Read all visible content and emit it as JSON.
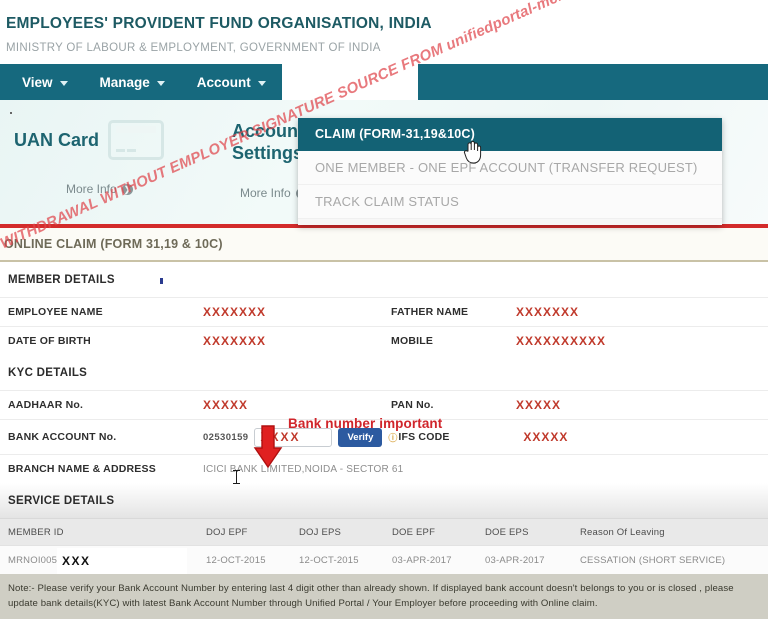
{
  "header": {
    "title": "EMPLOYEES' PROVIDENT FUND ORGANISATION, INDIA",
    "subtitle": "MINISTRY OF LABOUR & EMPLOYMENT, GOVERNMENT OF INDIA"
  },
  "nav": {
    "items": [
      {
        "label": "View",
        "has_caret": true
      },
      {
        "label": "Manage",
        "has_caret": true
      },
      {
        "label": "Account",
        "has_caret": true
      }
    ]
  },
  "dropdown": {
    "items": [
      {
        "label": "CLAIM (FORM-31,19&10C)",
        "active": true
      },
      {
        "label": "ONE MEMBER - ONE EPF ACCOUNT (TRANSFER REQUEST)",
        "active": false
      },
      {
        "label": "TRACK CLAIM STATUS",
        "active": false
      }
    ]
  },
  "hero": {
    "tiles": [
      {
        "label": "UAN Card",
        "more": "More Info"
      },
      {
        "label": "Account Settings",
        "more": "More Info"
      }
    ]
  },
  "claim_band": {
    "title": "ONLINE CLAIM (FORM 31,19 & 10C)"
  },
  "member_details": {
    "heading": "MEMBER DETAILS",
    "rows": [
      {
        "label": "EMPLOYEE NAME",
        "value": "XXXXXXX",
        "label2": "FATHER NAME",
        "value2": "XXXXXXX"
      },
      {
        "label": "DATE OF BIRTH",
        "value": "XXXXXXX",
        "label2": "MOBILE",
        "value2": "XXXXXXXXXX"
      }
    ]
  },
  "kyc_details": {
    "heading": "KYC DETAILS",
    "aadhaar_label": "AADHAAR No.",
    "aadhaar_value": "XXXXX",
    "pan_label": "PAN No.",
    "pan_value": "XXXXX",
    "bank_label": "BANK ACCOUNT No.",
    "bank_prefix": "02530159",
    "bank_input_value": "XXXX",
    "verify_label": "Verify",
    "info_icon": "info-icon",
    "ifs_label": "IFS CODE",
    "ifs_value": "XXXXX",
    "branch_label": "BRANCH NAME & ADDRESS",
    "branch_value": "ICICI BANK LIMITED,NOIDA - SECTOR 61"
  },
  "service_details": {
    "heading": "SERVICE DETAILS",
    "columns": [
      "MEMBER ID",
      "DOJ EPF",
      "DOJ EPS",
      "DOE EPF",
      "DOE EPS",
      "Reason Of Leaving"
    ],
    "row": {
      "member_id": "MRNOI00501",
      "member_id_redacted": "XXX",
      "doj_epf": "12-OCT-2015",
      "doj_eps": "12-OCT-2015",
      "doe_epf": "03-APR-2017",
      "doe_eps": "03-APR-2017",
      "reason": "CESSATION (SHORT SERVICE)"
    }
  },
  "note": {
    "text": "Note:- Please verify your Bank Account Number by entering last 4 digit other than already shown. If displayed bank account doesn't belongs to you or is closed , please update bank details(KYC) with latest Bank Account Number through Unified Portal / Your Employer before proceeding with Online claim."
  },
  "annotations": {
    "bank_note": "Bank number important",
    "watermark": "EPF WITHDRAWAL WITHOUT EMPLOYER SIGNATURE SOURCE FROM unifiedportal-mem.epfindia.gov.in PORTAL"
  },
  "colors": {
    "teal": "#16697e",
    "red_accent": "#d32b2b",
    "value_red": "#c0392b",
    "verify_blue": "#2c5aa0",
    "note_bg": "#cfcec4"
  }
}
